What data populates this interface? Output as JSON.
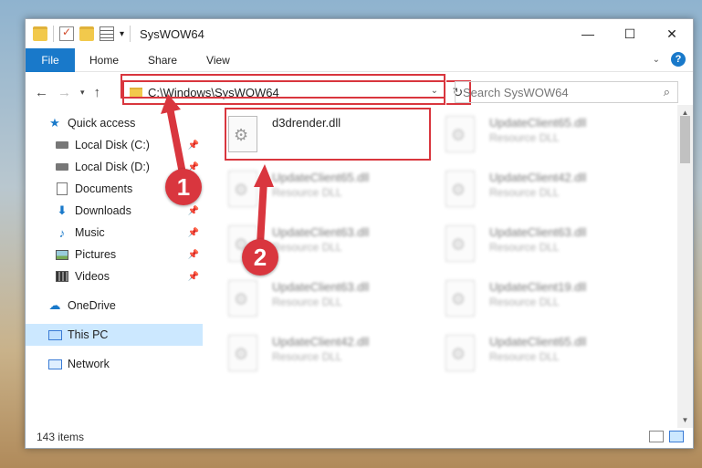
{
  "window": {
    "title": "SysWOW64",
    "minimize_glyph": "—",
    "maximize_glyph": "☐",
    "close_glyph": "✕"
  },
  "ribbon": {
    "file": "File",
    "tabs": [
      "Home",
      "Share",
      "View"
    ],
    "help": "?"
  },
  "address": {
    "path": "C:\\Windows\\SysWOW64",
    "search_placeholder": "Search SysWOW64"
  },
  "sidebar": {
    "items": [
      {
        "label": "Quick access",
        "icon": "star-icon"
      },
      {
        "label": "Local Disk (C:)",
        "icon": "disk-icon"
      },
      {
        "label": "Local Disk (D:)",
        "icon": "disk-icon"
      },
      {
        "label": "Documents",
        "icon": "documents-icon"
      },
      {
        "label": "Downloads",
        "icon": "download-icon"
      },
      {
        "label": "Music",
        "icon": "music-icon"
      },
      {
        "label": "Pictures",
        "icon": "pictures-icon"
      },
      {
        "label": "Videos",
        "icon": "videos-icon"
      },
      {
        "label": "OneDrive",
        "icon": "cloud-icon"
      },
      {
        "label": "This PC",
        "icon": "computer-icon"
      },
      {
        "label": "Network",
        "icon": "network-icon"
      }
    ]
  },
  "files": {
    "main": {
      "name": "d3drender.dll",
      "type": ""
    },
    "blurred": [
      {
        "name": "UpdateClient65.dll",
        "type": "Resource DLL"
      },
      {
        "name": "UpdateClient65.dll",
        "type": "Resource DLL"
      },
      {
        "name": "UpdateClient42.dll",
        "type": "Resource DLL"
      },
      {
        "name": "UpdateClient63.dll",
        "type": "Resource DLL"
      },
      {
        "name": "UpdateClient63.dll",
        "type": "Resource DLL"
      },
      {
        "name": "UpdateClient63.dll",
        "type": "Resource DLL"
      },
      {
        "name": "UpdateClient19.dll",
        "type": "Resource DLL"
      },
      {
        "name": "UpdateClient42.dll",
        "type": "Resource DLL"
      },
      {
        "name": "UpdateClient65.dll",
        "type": "Resource DLL"
      }
    ]
  },
  "status": {
    "count": "143 items"
  },
  "annotations": {
    "step1": "1",
    "step2": "2"
  },
  "colors": {
    "accent": "#1979ca",
    "highlight": "#d9363e"
  }
}
